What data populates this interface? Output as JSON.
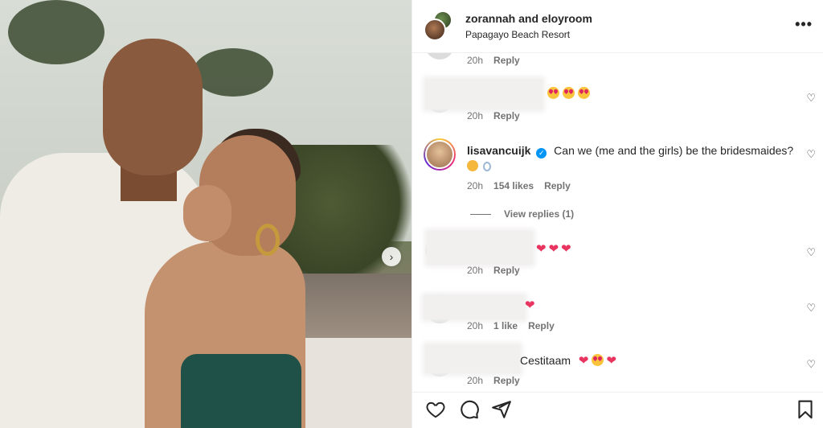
{
  "header": {
    "user1": "zorannah",
    "and": "and",
    "user2": "eloyroom",
    "location": "Papagayo Beach Resort"
  },
  "icons": {
    "more": "more-options-icon",
    "like": "heart-icon",
    "comment": "comment-icon",
    "share": "send-icon",
    "save": "bookmark-icon",
    "next": "chevron-right-icon"
  },
  "comments": [
    {
      "id": "c0",
      "time": "20h",
      "reply": "Reply"
    },
    {
      "id": "c1",
      "time": "20h",
      "reply": "Reply"
    },
    {
      "id": "lisa",
      "username": "lisavancuijk",
      "text": "Can we (me and the girls) be the bridesmaides?",
      "time": "20h",
      "likes": "154 likes",
      "reply": "Reply",
      "view_replies": "View replies (1)"
    },
    {
      "id": "c3",
      "time": "20h",
      "reply": "Reply"
    },
    {
      "id": "c4",
      "time": "20h",
      "likes": "1 like",
      "reply": "Reply"
    },
    {
      "id": "c5",
      "text_fragment": "Cestitaam",
      "time": "20h",
      "reply": "Reply"
    }
  ],
  "colors": {
    "verified": "#0095f6",
    "heart_emoji": "#e8345e",
    "secondary_text": "#737373"
  }
}
